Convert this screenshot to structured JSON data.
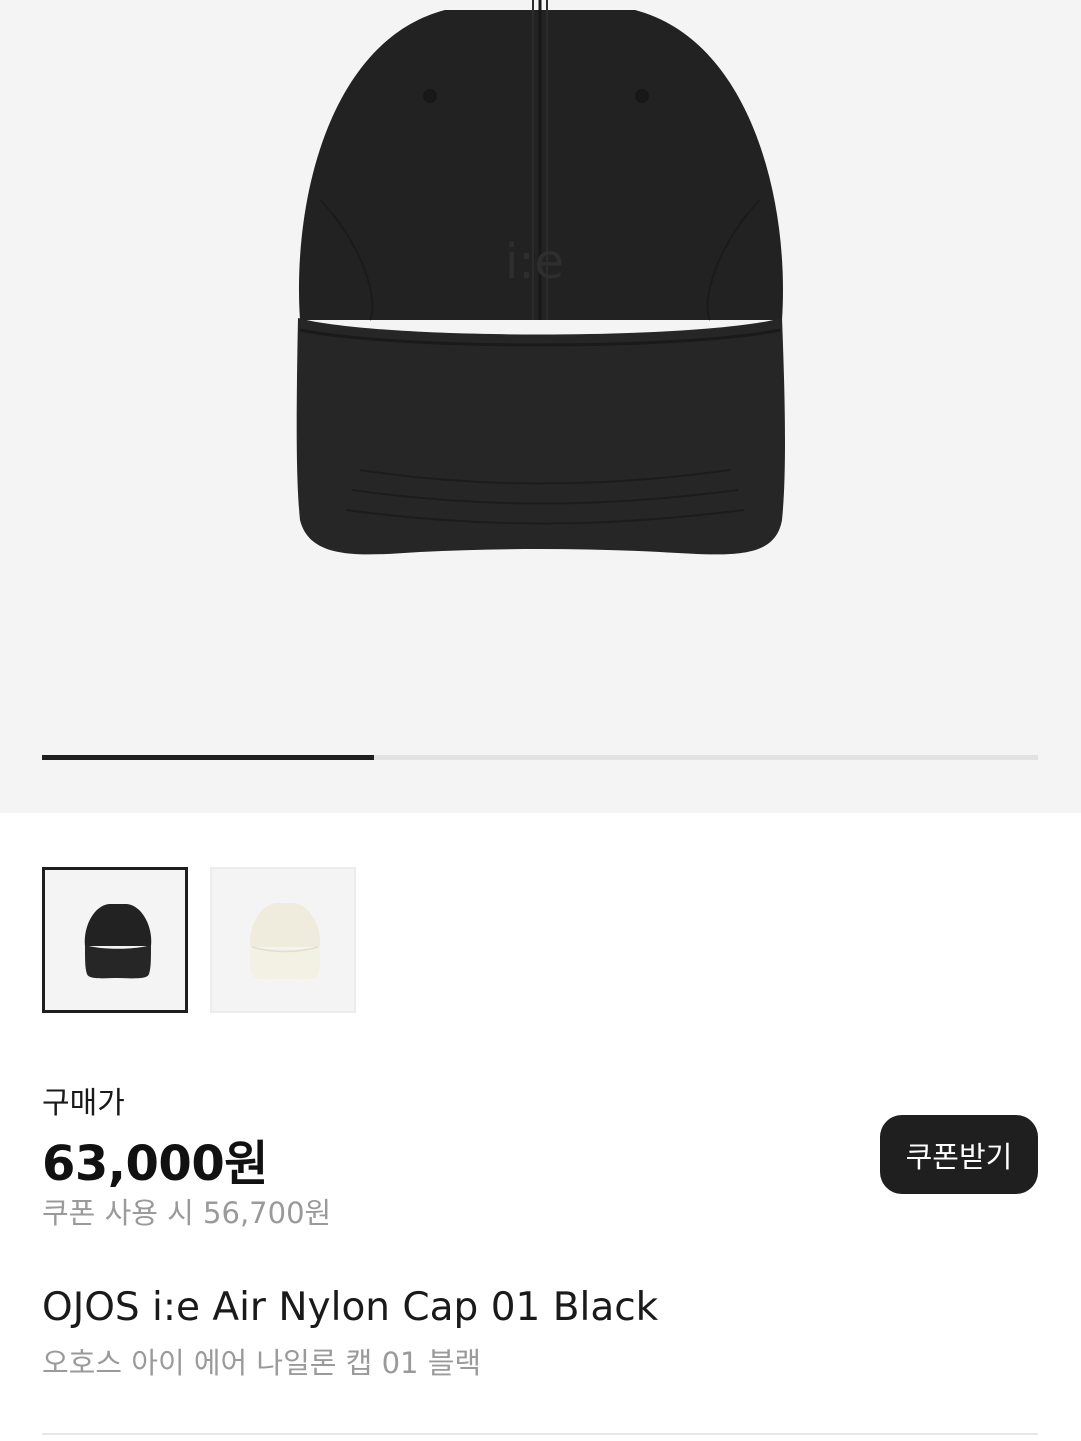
{
  "gallery": {
    "image_index": 1,
    "image_count": 3,
    "progress_fraction": 0.333,
    "main_image": "black-cap-front",
    "logo_text": "i:e"
  },
  "color_options": [
    {
      "name": "Black",
      "color": "#1e1e1e",
      "selected": true
    },
    {
      "name": "Ivory",
      "color": "#eeeadb",
      "selected": false
    }
  ],
  "price": {
    "label": "구매가",
    "amount": "63,000원",
    "coupon_text": "쿠폰 사용 시 56,700원",
    "coupon_button": "쿠폰받기"
  },
  "product": {
    "name_en": "OJOS i:e Air Nylon Cap 01 Black",
    "name_ko": "오호스 아이 에어 나일론 캡 01 블랙"
  },
  "colors": {
    "hero_bg": "#f4f4f4",
    "text_primary": "#111111",
    "text_secondary": "#9a9a9a",
    "button_bg": "#1f1f1f"
  }
}
